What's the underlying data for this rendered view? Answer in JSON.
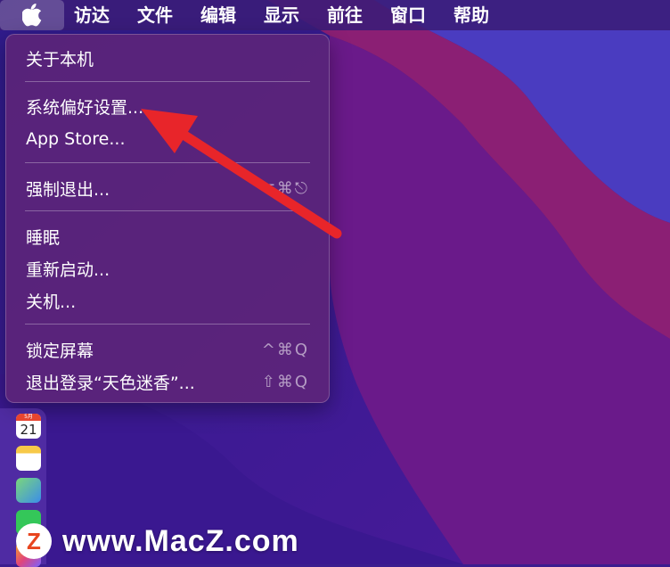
{
  "menubar": {
    "items": [
      "访达",
      "文件",
      "编辑",
      "显示",
      "前往",
      "窗口",
      "帮助"
    ]
  },
  "apple_menu": {
    "about": "关于本机",
    "system_prefs": "系统偏好设置...",
    "app_store": "App Store...",
    "force_quit": "强制退出...",
    "force_quit_shortcut": "⌥⌘⎋",
    "sleep": "睡眠",
    "restart": "重新启动...",
    "shutdown": "关机...",
    "lock_screen": "锁定屏幕",
    "lock_screen_shortcut": "^⌘Q",
    "logout": "退出登录“天色迷香”...",
    "logout_shortcut": "⇧⌘Q"
  },
  "dock": {
    "calendar_month": "5月",
    "calendar_day": "21"
  },
  "watermark": {
    "logo_letter": "Z",
    "text": "www.MacZ.com"
  },
  "colors": {
    "arrow": "#e8252a",
    "menubar": "#3a1c78",
    "menu": "#602676"
  }
}
